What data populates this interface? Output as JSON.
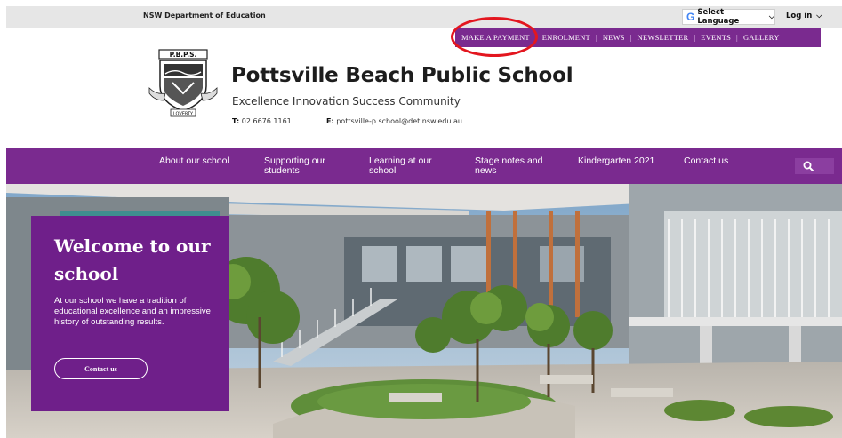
{
  "utility": {
    "department": "NSW Department of Education",
    "language_label": "Select Language",
    "login_label": "Log in"
  },
  "quick_links": [
    "MAKE A PAYMENT",
    "ENROLMENT",
    "NEWS",
    "NEWSLETTER",
    "EVENTS",
    "GALLERY"
  ],
  "header": {
    "crest_text_top": "P.B.P.S.",
    "crest_text_motto": "LOVERTY",
    "school_name": "Pottsville Beach Public School",
    "tagline": "Excellence Innovation Success Community",
    "phone_label": "T:",
    "phone": "02 6676 1161",
    "email_label": "E:",
    "email": "pottsville-p.school@det.nsw.edu.au"
  },
  "nav": {
    "items": [
      "About our school",
      "Supporting our\nstudents",
      "Learning at our\nschool",
      "Stage notes and\nnews",
      "Kindergarten 2021",
      "Contact us"
    ]
  },
  "hero": {
    "welcome_title": "Welcome to our school",
    "welcome_text": "At our school we have a tradition of educational excellence and an impressive history of outstanding results.",
    "cta_label": "Contact us"
  },
  "colors": {
    "brand_purple": "#7a2a8f",
    "panel_purple": "#6f1f8a",
    "highlight_red": "#e3161f"
  }
}
